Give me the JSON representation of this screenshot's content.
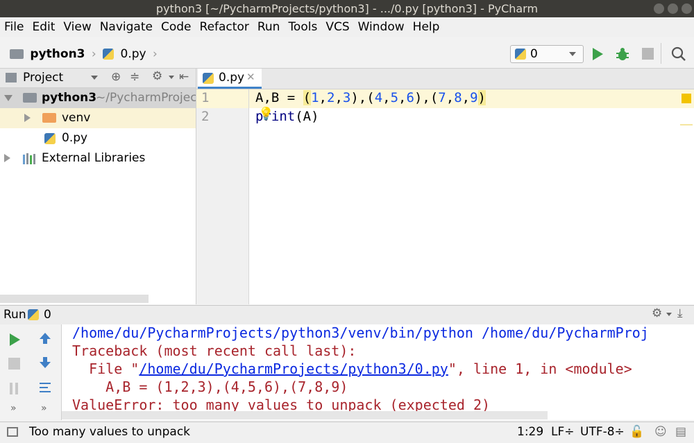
{
  "window": {
    "title": "python3 [~/PycharmProjects/python3] - .../0.py [python3] - PyCharm"
  },
  "menu": [
    "File",
    "Edit",
    "View",
    "Navigate",
    "Code",
    "Refactor",
    "Run",
    "Tools",
    "VCS",
    "Window",
    "Help"
  ],
  "breadcrumb": {
    "project": "python3",
    "file": "0.py"
  },
  "run_config": {
    "selected": "0"
  },
  "project_panel": {
    "title": "Project",
    "root": {
      "name": "python3",
      "path": "~/PycharmProject"
    },
    "venv": "venv",
    "file": "0.py",
    "external": "External Libraries"
  },
  "editor": {
    "tab": "0.py",
    "line_numbers": [
      "1",
      "2"
    ],
    "line1_prefix": "A,B = ",
    "line1_nums": [
      "1",
      "2",
      "3",
      "4",
      "5",
      "6",
      "7",
      "8",
      "9"
    ],
    "line2_prefix": "print",
    "line2_suffix": "(A)"
  },
  "run_panel": {
    "label": "Run",
    "config": "0",
    "lines": [
      "/home/du/PycharmProjects/python3/venv/bin/python /home/du/PycharmProj",
      "Traceback (most recent call last):",
      "  File \"",
      "/home/du/PycharmProjects/python3/0.py",
      "\", line 1, in <module>",
      "    A,B = (1,2,3),(4,5,6),(7,8,9)",
      "ValueError: too many values to unpack (expected 2)"
    ]
  },
  "status": {
    "message": "Too many values to unpack",
    "position": "1:29",
    "line_sep": "LF÷",
    "encoding": "UTF-8÷"
  },
  "colors": {
    "accent": "#4083c9",
    "run_green": "#3ca14a",
    "error_red": "#a8242c",
    "link_blue": "#0b29e0",
    "number_blue": "#1750eb"
  }
}
